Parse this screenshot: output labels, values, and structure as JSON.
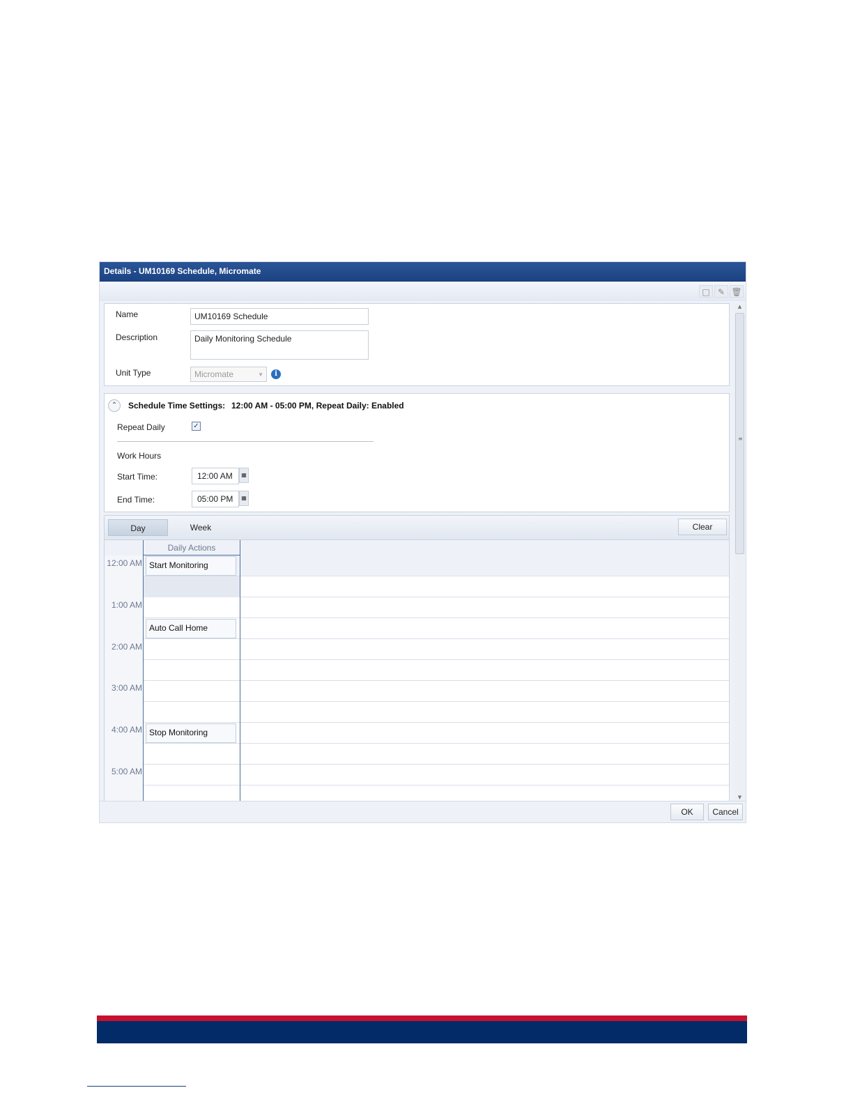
{
  "window": {
    "title": "Details - UM10169 Schedule, Micromate"
  },
  "toolbar": {
    "icons": [
      "new-document-icon",
      "edit-pencil-icon",
      "delete-trash-icon"
    ]
  },
  "general": {
    "name_label": "Name",
    "name_value": "UM10169 Schedule",
    "description_label": "Description",
    "description_value": "Daily Monitoring Schedule",
    "unit_type_label": "Unit Type",
    "unit_type_value": "Micromate"
  },
  "time_settings": {
    "title": "Schedule Time Settings:",
    "summary": "12:00 AM - 05:00 PM, Repeat Daily: Enabled",
    "repeat_daily_label": "Repeat Daily",
    "repeat_daily_checked": true,
    "work_hours_label": "Work Hours",
    "start_time_label": "Start Time:",
    "start_time_value": "12:00 AM",
    "end_time_label": "End Time:",
    "end_time_value": "05:00 PM"
  },
  "view_tabs": {
    "day": "Day",
    "week": "Week",
    "active": "Day",
    "clear_label": "Clear"
  },
  "calendar": {
    "column_header": "Daily Actions",
    "time_labels": [
      "12:00 AM",
      "1:00 AM",
      "2:00 AM",
      "3:00 AM",
      "4:00 AM",
      "5:00 AM"
    ],
    "events": [
      {
        "label": "Start Monitoring",
        "time": "12:00 AM"
      },
      {
        "label": "Auto Call Home",
        "time": "1:30 AM"
      },
      {
        "label": "Stop Monitoring",
        "time": "4:00 AM"
      }
    ]
  },
  "footer": {
    "ok_label": "OK",
    "cancel_label": "Cancel"
  },
  "colors": {
    "title_bar": "#1c4383",
    "brand_red": "#c8102e",
    "brand_navy": "#032b68"
  }
}
